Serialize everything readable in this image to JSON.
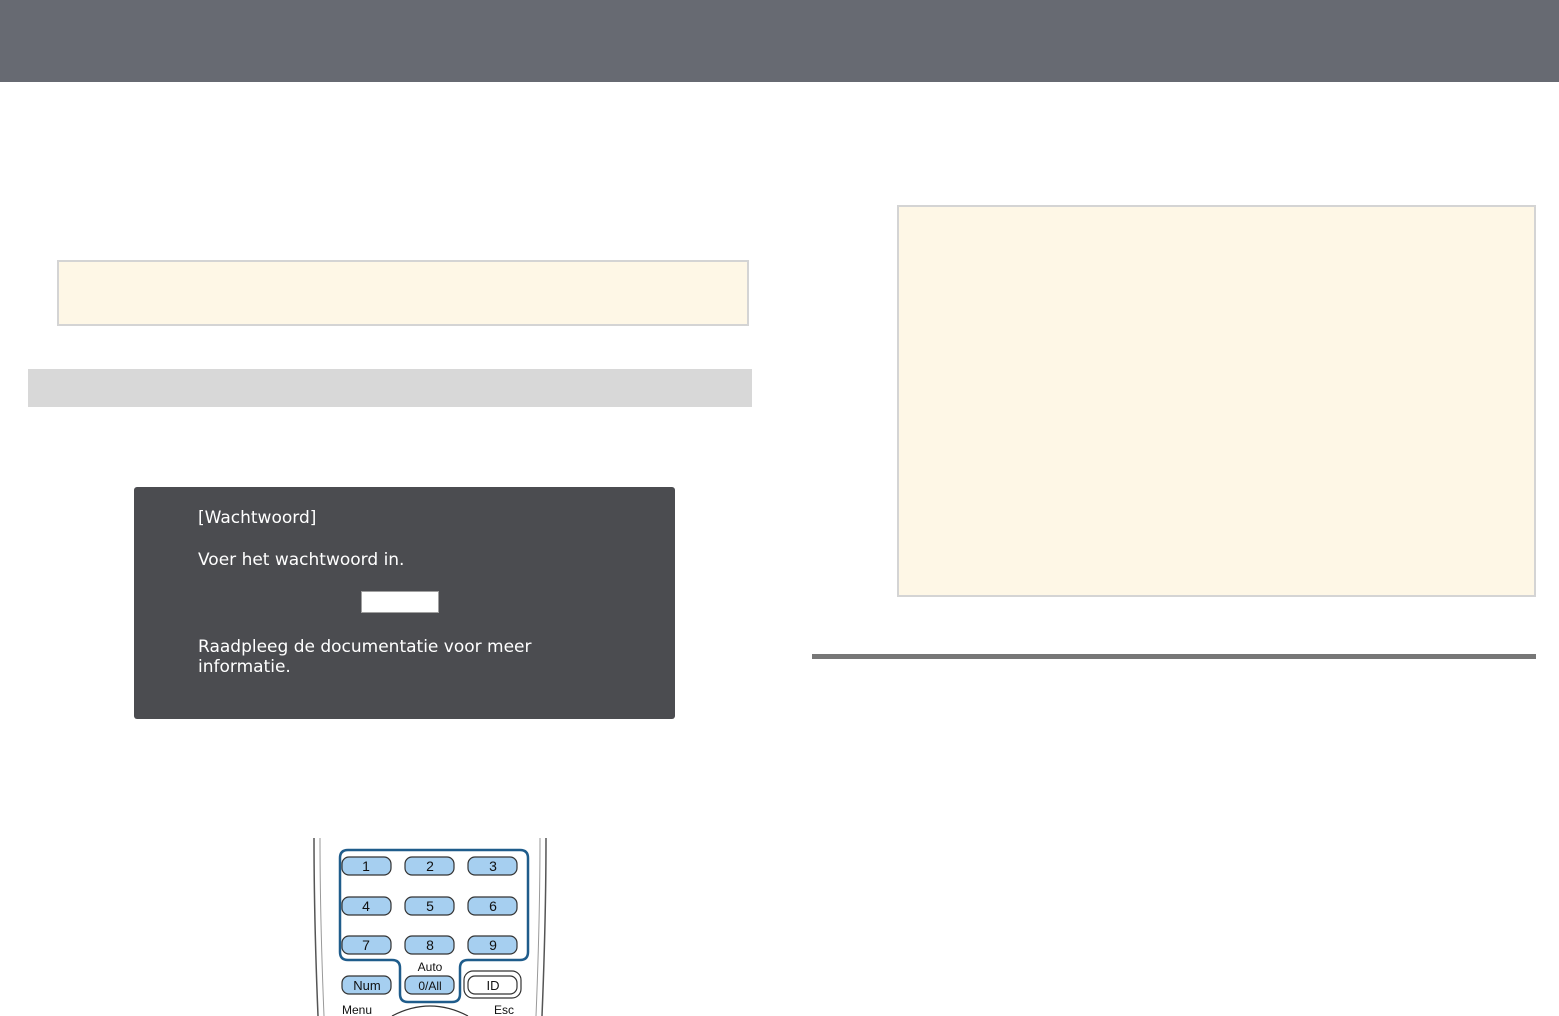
{
  "dialog": {
    "title": "[Wachtwoord]",
    "prompt": "Voer het wachtwoord in.",
    "password_value": "",
    "help": "Raadpleeg de documentatie voor meer\ninformatie."
  },
  "remote": {
    "keys": {
      "k1": "1",
      "k2": "2",
      "k3": "3",
      "k4": "4",
      "k5": "5",
      "k6": "6",
      "k7": "7",
      "k8": "8",
      "k9": "9",
      "num": "Num",
      "zero_all": "0/All",
      "id": "ID"
    },
    "labels": {
      "auto": "Auto",
      "menu": "Menu",
      "esc": "Esc"
    }
  },
  "colors": {
    "topbar": "#676a72",
    "note_fill": "#fef7e6",
    "dialog_bg": "#4b4c50",
    "key_fill": "#a6cff0",
    "highlight": "#1f5c8b"
  }
}
